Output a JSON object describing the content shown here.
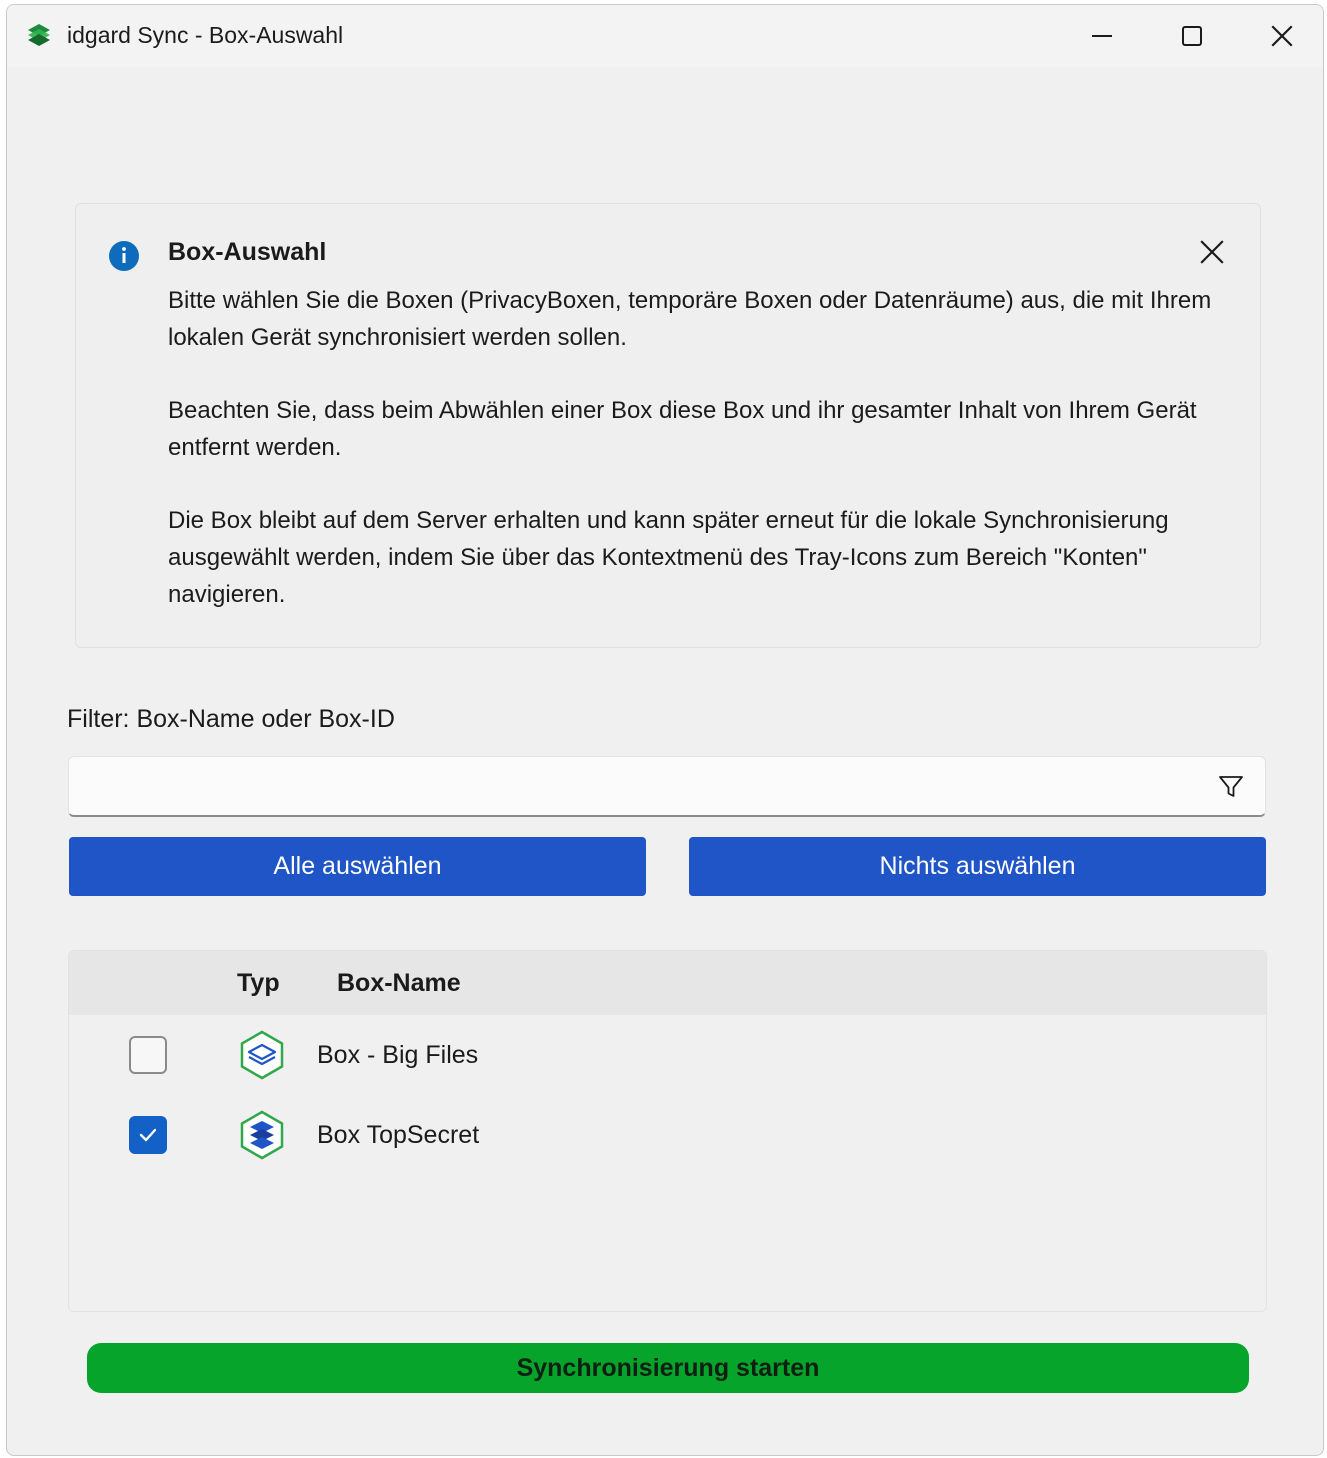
{
  "window": {
    "title": "idgard Sync - Box-Auswahl",
    "icons": {
      "app": "idgard-layers-icon",
      "minimize": "minimize-icon",
      "maximize": "maximize-icon",
      "close": "close-icon"
    }
  },
  "info_panel": {
    "title": "Box-Auswahl",
    "icon": "info-icon",
    "close_icon": "close-icon",
    "paragraphs": [
      "Bitte wählen Sie die Boxen (PrivacyBoxen, temporäre Boxen oder Datenräume) aus, die mit Ihrem lokalen Gerät synchronisiert werden sollen.",
      "Beachten Sie, dass beim Abwählen einer Box diese Box und ihr gesamter Inhalt von Ihrem Gerät entfernt werden.",
      "Die Box bleibt auf dem Server erhalten und kann später erneut für die lokale Synchronisierung ausgewählt werden, indem Sie über das Kontextmenü des Tray-Icons zum Bereich \"Konten\" navigieren."
    ]
  },
  "filter": {
    "label": "Filter: Box-Name oder Box-ID",
    "value": "",
    "placeholder": "",
    "icon": "filter-icon"
  },
  "buttons": {
    "select_all": "Alle auswählen",
    "select_none": "Nichts auswählen",
    "start_sync": "Synchronisierung starten"
  },
  "table": {
    "columns": [
      "",
      "Typ",
      "Box-Name"
    ],
    "rows": [
      {
        "checked": false,
        "type_icon": "box-outline-icon",
        "name": "Box - Big Files"
      },
      {
        "checked": true,
        "type_icon": "box-stack-icon",
        "name": "Box TopSecret"
      }
    ]
  },
  "colors": {
    "accent_blue": "#1f55c7",
    "checkbox_blue": "#1361c6",
    "start_green": "#06a42a",
    "info_blue": "#0f6cbd",
    "icon_green": "#2ea84a"
  }
}
